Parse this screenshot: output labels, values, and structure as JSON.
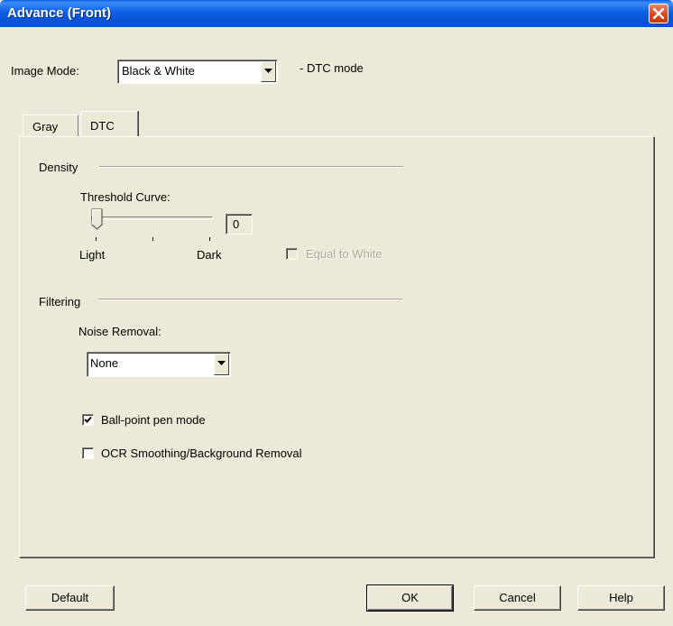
{
  "window": {
    "title": "Advance (Front)"
  },
  "image_mode": {
    "label": "Image Mode:",
    "value": "Black & White",
    "note": "- DTC mode"
  },
  "tabs": [
    {
      "label": "Gray",
      "active": false
    },
    {
      "label": "DTC",
      "active": true
    }
  ],
  "density": {
    "title": "Density",
    "threshold_label": "Threshold Curve:",
    "slider_value": "0",
    "light_label": "Light",
    "dark_label": "Dark",
    "equal_to_white_label": "Equal to White",
    "equal_to_white_checked": false,
    "equal_to_white_enabled": false
  },
  "filtering": {
    "title": "Filtering",
    "noise_removal_label": "Noise Removal:",
    "noise_removal_value": "None",
    "ballpoint_label": "Ball-point pen mode",
    "ballpoint_checked": true,
    "ocr_label": "OCR Smoothing/Background Removal",
    "ocr_checked": false
  },
  "buttons": {
    "default": "Default",
    "ok": "OK",
    "cancel": "Cancel",
    "help": "Help"
  },
  "colors": {
    "title_bar": "#0a5ee8",
    "face": "#ece9d8",
    "close": "#d9481f"
  }
}
